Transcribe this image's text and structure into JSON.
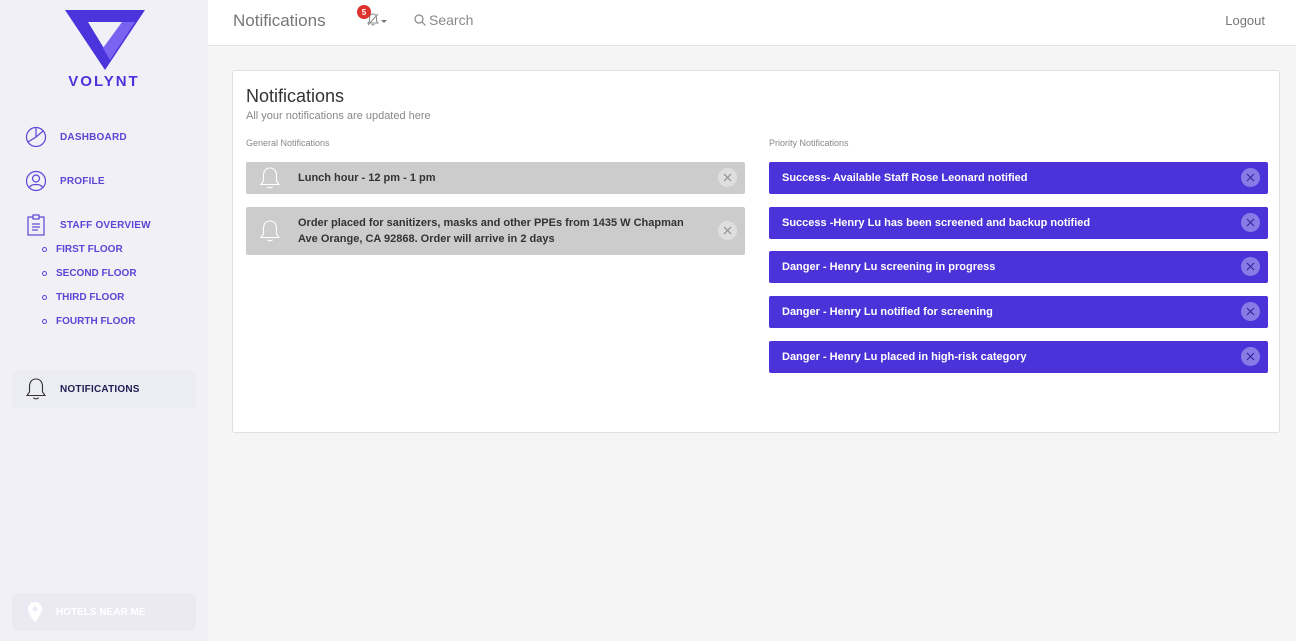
{
  "brand": {
    "name": "VOLYNT",
    "accent": "#4b34dc"
  },
  "sidebar": {
    "items": [
      {
        "label": "DASHBOARD",
        "icon": "pie-chart-icon"
      },
      {
        "label": "PROFILE",
        "icon": "user-icon"
      },
      {
        "label": "STAFF OVERVIEW",
        "icon": "clipboard-icon"
      },
      {
        "label": "NOTIFICATIONS",
        "icon": "bell-icon"
      }
    ],
    "floors": [
      "FIRST FLOOR",
      "SECOND FLOOR",
      "THIRD FLOOR",
      "FOURTH FLOOR"
    ],
    "bottom": {
      "label": "HOTELS NEAR ME",
      "icon": "map-pin-icon"
    }
  },
  "topbar": {
    "title": "Notifications",
    "badge_count": "5",
    "search_label": "Search",
    "logout_label": "Logout"
  },
  "card": {
    "title": "Notifications",
    "subtitle": "All your notifications are updated here",
    "general_label": "General Notifications",
    "priority_label": "Priority Notifications",
    "general": [
      "Lunch hour - 12 pm - 1 pm",
      "Order placed for sanitizers, masks and other PPEs from 1435 W Chapman Ave Orange, CA 92868. Order will arrive in 2 days"
    ],
    "priority": [
      "Success- Available Staff Rose Leonard notified",
      "Success -Henry Lu has been screened and backup notified",
      "Danger - Henry Lu screening in progress",
      "Danger - Henry Lu notified for screening",
      "Danger - Henry Lu placed in high-risk category"
    ]
  },
  "colors": {
    "priority_bg": "#4b33d9",
    "general_bg": "#cccccc",
    "badge": "#e03131"
  }
}
